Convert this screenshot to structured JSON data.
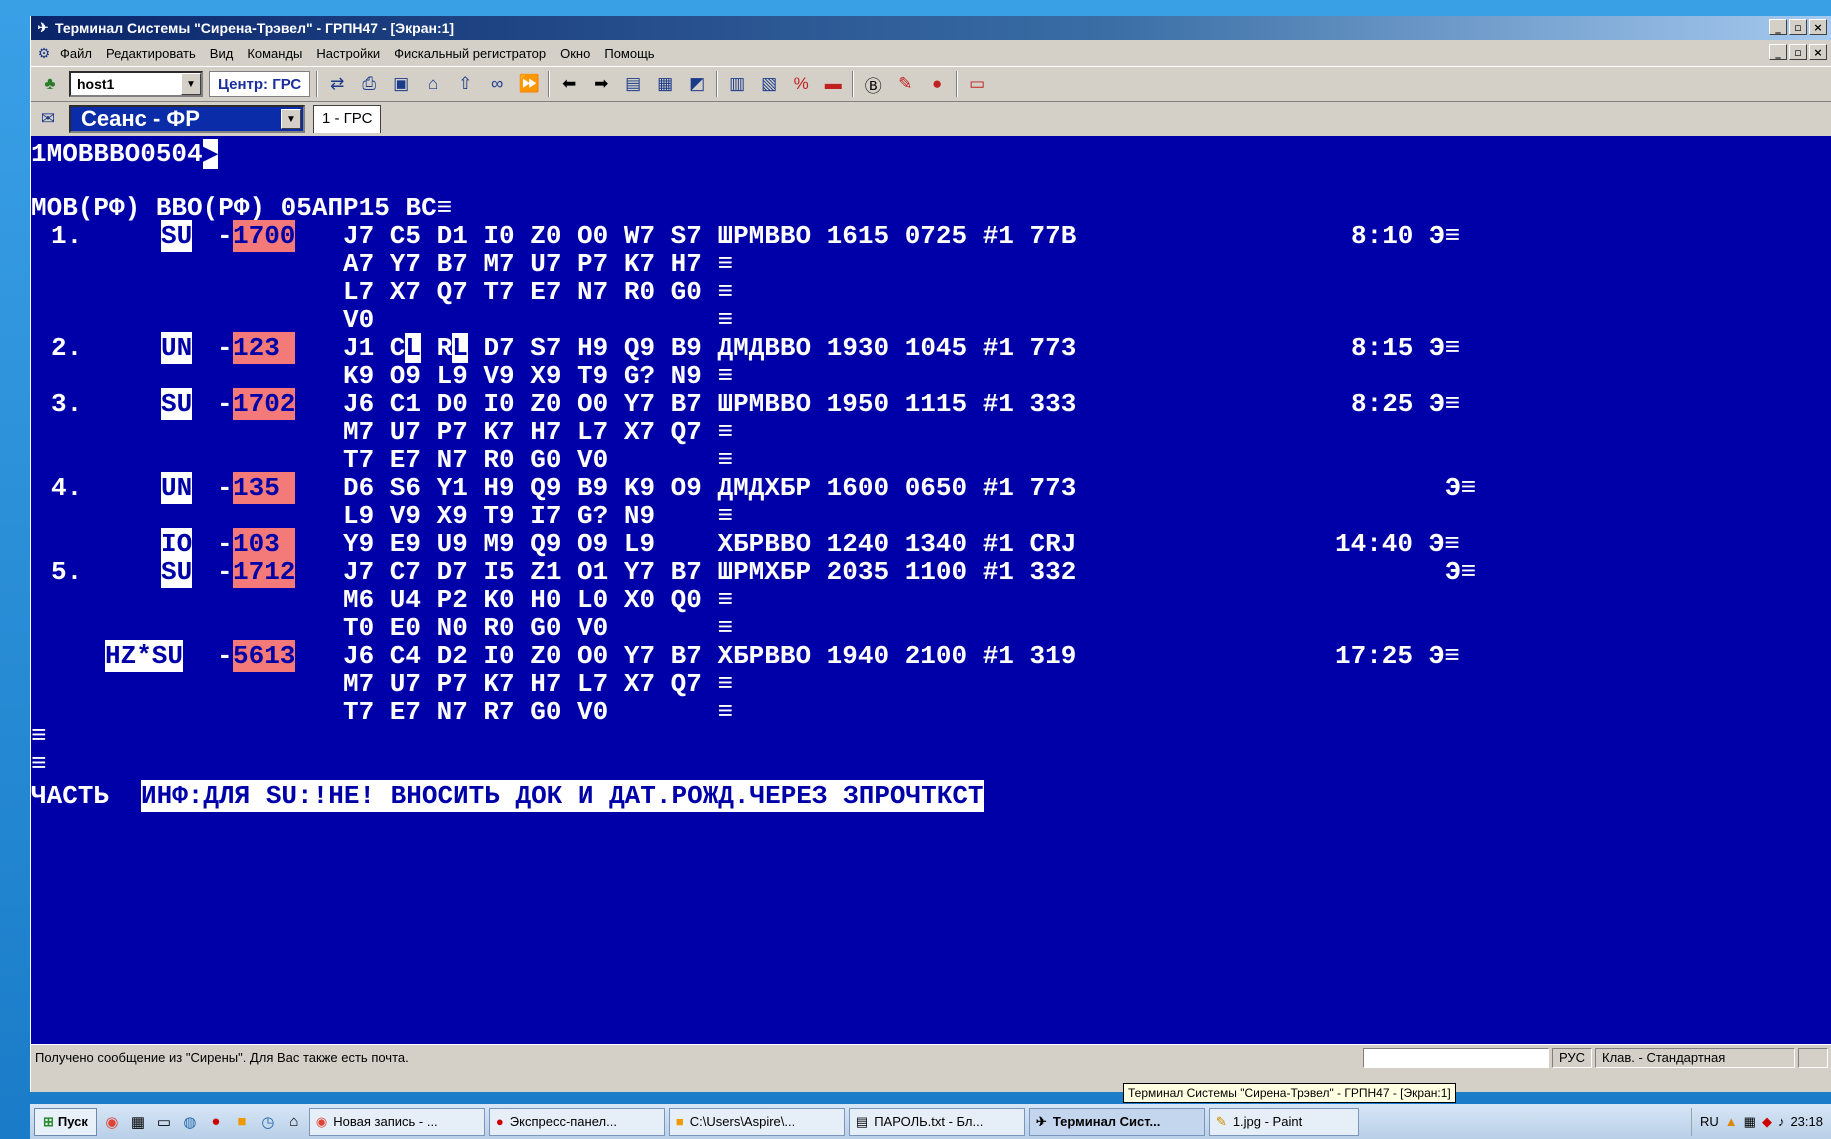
{
  "window": {
    "title": "Терминал Системы \"Сирена-Трэвел\" - ГРПН47 - [Экран:1]",
    "min": "_",
    "max": "▫",
    "close": "×"
  },
  "menu": [
    "Файл",
    "Редактировать",
    "Вид",
    "Команды",
    "Настройки",
    "Фискальный регистратор",
    "Окно",
    "Помощь"
  ],
  "toolbar": {
    "host": "host1",
    "center": "Центр: ГРС"
  },
  "session": {
    "name": "Сеанс - ФР",
    "tab": "1 - ГРС"
  },
  "terminal": {
    "l0": "1МОВВВО0504",
    "l2": "МОВ(РФ) ВВО(РФ) 05АПР15 ВС≡",
    "r1n": "1.",
    "r1a": "SU",
    "r1b": "1700",
    "r1c": "J7 C5 D1 I0 Z0 O0 W7 S7 ШРМВВО 1615 0725 #1 77В",
    "r1t": "8:10 Э≡",
    "r1d": "A7 Y7 B7 M7 U7 P7 K7 H7 ≡",
    "r1e": "L7 X7 Q7 T7 E7 N7 R0 G0 ≡",
    "r1f": "V0                      ≡",
    "r2n": "2.",
    "r2a": "UN",
    "r2b": "123",
    "r2c1": "J1 C",
    "r2c2": "L",
    "r2c3": " R",
    "r2c4": "L",
    "r2c5": " D7 S7 H9 Q9 B9 ДМДВВО 1930 1045 #1 773",
    "r2t": "8:15 Э≡",
    "r2d": "K9 O9 L9 V9 X9 T9 G? N9 ≡",
    "r3n": "3.",
    "r3a": "SU",
    "r3b": "1702",
    "r3c": "J6 C1 D0 I0 Z0 O0 Y7 B7 ШРМВВО 1950 1115 #1 333",
    "r3t": "8:25 Э≡",
    "r3d": "M7 U7 P7 K7 H7 L7 X7 Q7 ≡",
    "r3e": "T7 E7 N7 R0 G0 V0       ≡",
    "r4n": "4.",
    "r4a": "UN",
    "r4b": "135",
    "r4c": "D6 S6 Y1 H9 Q9 B9 K9 O9 ДМДХБР 1600 0650 #1 773",
    "r4t": "Э≡",
    "r4d": "L9 V9 X9 T9 I7 G? N9    ≡",
    "r4ea": "IO",
    "r4eb": "103",
    "r4ec": "Y9 E9 U9 M9 Q9 O9 L9    ХБРВВО 1240 1340 #1 CRJ",
    "r4et": "14:40 Э≡",
    "r5n": "5.",
    "r5a": "SU",
    "r5b": "1712",
    "r5c": "J7 C7 D7 I5 Z1 O1 Y7 B7 ШРМХБР 2035 1100 #1 332",
    "r5t": "Э≡",
    "r5d": "M6 U4 P2 K0 H0 L0 X0 Q0 ≡",
    "r5e": "T0 E0 N0 R0 G0 V0       ≡",
    "r6a": "HZ*SU",
    "r6b": "5613",
    "r6c": "J6 C4 D2 I0 Z0 O0 Y7 B7 ХБРВВО 1940 2100 #1 319",
    "r6t": "17:25 Э≡",
    "r6d": "M7 U7 P7 K7 H7 L7 X7 Q7 ≡",
    "r6e": "T7 E7 N7 R7 G0 V0       ≡",
    "eq": "≡",
    "partLabel": "ЧАСТЬ",
    "partText": "ИНФ:ДЛЯ SU:!НЕ! ВНОСИТЬ ДОК И ДАТ.РОЖД.ЧЕРЕЗ ЗПРОЧТКСТ"
  },
  "status": {
    "message": "Получено сообщение из \"Сирены\". Для Вас также есть почта.",
    "lang": "РУС",
    "kb": "Клав. - Стандартная"
  },
  "tooltip": "Терминал Системы \"Сирена-Трэвел\" - ГРПН47 - [Экран:1]",
  "taskbar": {
    "start": "Пуск",
    "tasks": [
      "Новая запись - ...",
      "Экспресс-панел...",
      "C:\\Users\\Aspire\\...",
      "ПАРОЛЬ.txt - Бл...",
      "Терминал Сист...",
      "1.jpg - Paint"
    ],
    "lang": "RU",
    "time": "23:18"
  }
}
